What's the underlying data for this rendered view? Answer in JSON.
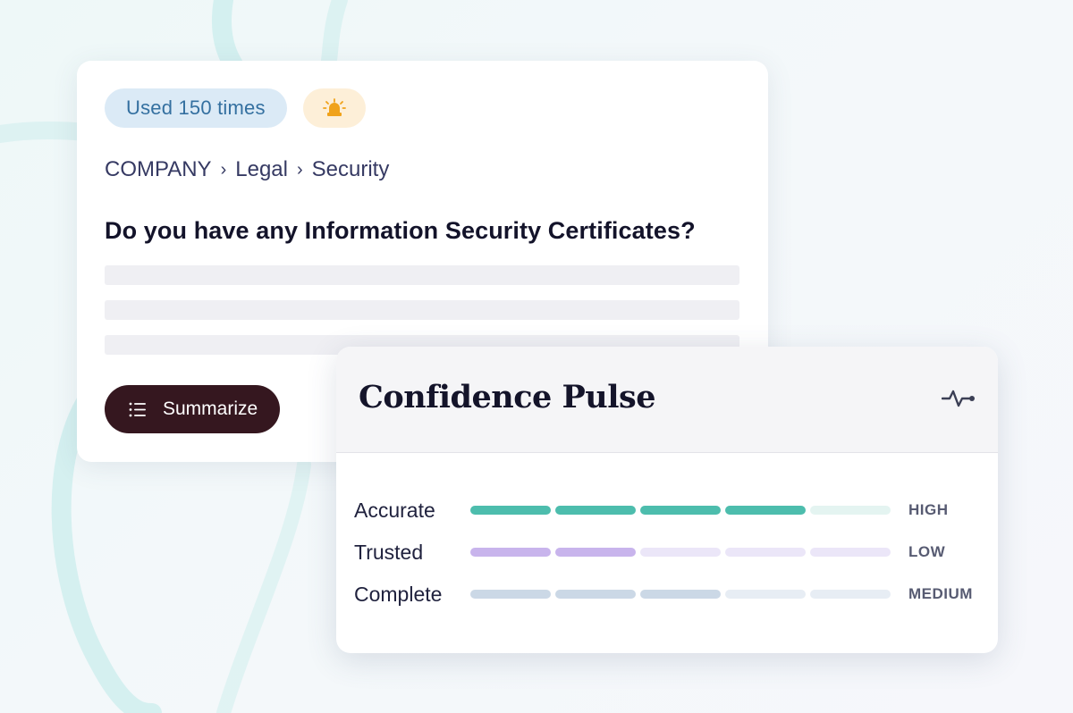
{
  "card": {
    "usage_badge": "Used 150 times",
    "alert_icon": "siren-icon",
    "breadcrumb": [
      "COMPANY",
      "Legal",
      "Security"
    ],
    "question": "Do you have any Information Security Certificates?",
    "summarize_label": "Summarize"
  },
  "confidence": {
    "title": "Confidence Pulse",
    "icon": "pulse-icon",
    "metrics": [
      {
        "label": "Accurate",
        "level": "HIGH",
        "filled": 4,
        "total": 5,
        "color": "#4dbdad",
        "empty_color": "#e4f4f1"
      },
      {
        "label": "Trusted",
        "level": "LOW",
        "filled": 2,
        "total": 5,
        "color": "#c8b4ec",
        "empty_color": "#ebe6f8"
      },
      {
        "label": "Complete",
        "level": "MEDIUM",
        "filled": 3,
        "total": 5,
        "color": "#cbd8e6",
        "empty_color": "#e7edf4"
      }
    ]
  }
}
